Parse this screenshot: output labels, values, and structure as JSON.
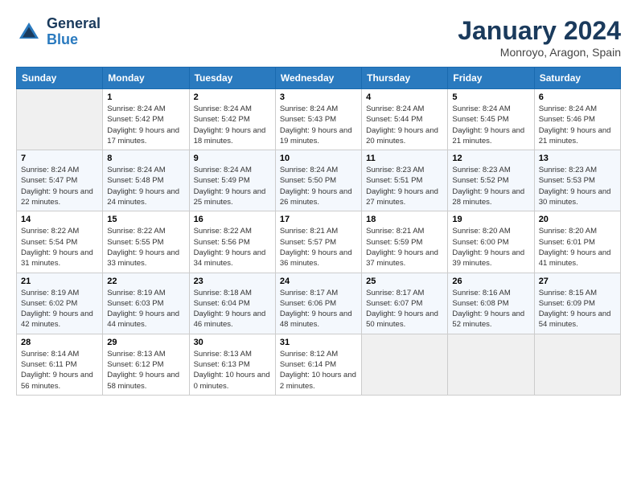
{
  "header": {
    "logo_line1": "General",
    "logo_line2": "Blue",
    "title": "January 2024",
    "subtitle": "Monroyo, Aragon, Spain"
  },
  "weekdays": [
    "Sunday",
    "Monday",
    "Tuesday",
    "Wednesday",
    "Thursday",
    "Friday",
    "Saturday"
  ],
  "weeks": [
    [
      {
        "day": "",
        "sunrise": "",
        "sunset": "",
        "daylight": ""
      },
      {
        "day": "1",
        "sunrise": "Sunrise: 8:24 AM",
        "sunset": "Sunset: 5:42 PM",
        "daylight": "Daylight: 9 hours and 17 minutes."
      },
      {
        "day": "2",
        "sunrise": "Sunrise: 8:24 AM",
        "sunset": "Sunset: 5:42 PM",
        "daylight": "Daylight: 9 hours and 18 minutes."
      },
      {
        "day": "3",
        "sunrise": "Sunrise: 8:24 AM",
        "sunset": "Sunset: 5:43 PM",
        "daylight": "Daylight: 9 hours and 19 minutes."
      },
      {
        "day": "4",
        "sunrise": "Sunrise: 8:24 AM",
        "sunset": "Sunset: 5:44 PM",
        "daylight": "Daylight: 9 hours and 20 minutes."
      },
      {
        "day": "5",
        "sunrise": "Sunrise: 8:24 AM",
        "sunset": "Sunset: 5:45 PM",
        "daylight": "Daylight: 9 hours and 21 minutes."
      },
      {
        "day": "6",
        "sunrise": "Sunrise: 8:24 AM",
        "sunset": "Sunset: 5:46 PM",
        "daylight": "Daylight: 9 hours and 21 minutes."
      }
    ],
    [
      {
        "day": "7",
        "sunrise": "Sunrise: 8:24 AM",
        "sunset": "Sunset: 5:47 PM",
        "daylight": "Daylight: 9 hours and 22 minutes."
      },
      {
        "day": "8",
        "sunrise": "Sunrise: 8:24 AM",
        "sunset": "Sunset: 5:48 PM",
        "daylight": "Daylight: 9 hours and 24 minutes."
      },
      {
        "day": "9",
        "sunrise": "Sunrise: 8:24 AM",
        "sunset": "Sunset: 5:49 PM",
        "daylight": "Daylight: 9 hours and 25 minutes."
      },
      {
        "day": "10",
        "sunrise": "Sunrise: 8:24 AM",
        "sunset": "Sunset: 5:50 PM",
        "daylight": "Daylight: 9 hours and 26 minutes."
      },
      {
        "day": "11",
        "sunrise": "Sunrise: 8:23 AM",
        "sunset": "Sunset: 5:51 PM",
        "daylight": "Daylight: 9 hours and 27 minutes."
      },
      {
        "day": "12",
        "sunrise": "Sunrise: 8:23 AM",
        "sunset": "Sunset: 5:52 PM",
        "daylight": "Daylight: 9 hours and 28 minutes."
      },
      {
        "day": "13",
        "sunrise": "Sunrise: 8:23 AM",
        "sunset": "Sunset: 5:53 PM",
        "daylight": "Daylight: 9 hours and 30 minutes."
      }
    ],
    [
      {
        "day": "14",
        "sunrise": "Sunrise: 8:22 AM",
        "sunset": "Sunset: 5:54 PM",
        "daylight": "Daylight: 9 hours and 31 minutes."
      },
      {
        "day": "15",
        "sunrise": "Sunrise: 8:22 AM",
        "sunset": "Sunset: 5:55 PM",
        "daylight": "Daylight: 9 hours and 33 minutes."
      },
      {
        "day": "16",
        "sunrise": "Sunrise: 8:22 AM",
        "sunset": "Sunset: 5:56 PM",
        "daylight": "Daylight: 9 hours and 34 minutes."
      },
      {
        "day": "17",
        "sunrise": "Sunrise: 8:21 AM",
        "sunset": "Sunset: 5:57 PM",
        "daylight": "Daylight: 9 hours and 36 minutes."
      },
      {
        "day": "18",
        "sunrise": "Sunrise: 8:21 AM",
        "sunset": "Sunset: 5:59 PM",
        "daylight": "Daylight: 9 hours and 37 minutes."
      },
      {
        "day": "19",
        "sunrise": "Sunrise: 8:20 AM",
        "sunset": "Sunset: 6:00 PM",
        "daylight": "Daylight: 9 hours and 39 minutes."
      },
      {
        "day": "20",
        "sunrise": "Sunrise: 8:20 AM",
        "sunset": "Sunset: 6:01 PM",
        "daylight": "Daylight: 9 hours and 41 minutes."
      }
    ],
    [
      {
        "day": "21",
        "sunrise": "Sunrise: 8:19 AM",
        "sunset": "Sunset: 6:02 PM",
        "daylight": "Daylight: 9 hours and 42 minutes."
      },
      {
        "day": "22",
        "sunrise": "Sunrise: 8:19 AM",
        "sunset": "Sunset: 6:03 PM",
        "daylight": "Daylight: 9 hours and 44 minutes."
      },
      {
        "day": "23",
        "sunrise": "Sunrise: 8:18 AM",
        "sunset": "Sunset: 6:04 PM",
        "daylight": "Daylight: 9 hours and 46 minutes."
      },
      {
        "day": "24",
        "sunrise": "Sunrise: 8:17 AM",
        "sunset": "Sunset: 6:06 PM",
        "daylight": "Daylight: 9 hours and 48 minutes."
      },
      {
        "day": "25",
        "sunrise": "Sunrise: 8:17 AM",
        "sunset": "Sunset: 6:07 PM",
        "daylight": "Daylight: 9 hours and 50 minutes."
      },
      {
        "day": "26",
        "sunrise": "Sunrise: 8:16 AM",
        "sunset": "Sunset: 6:08 PM",
        "daylight": "Daylight: 9 hours and 52 minutes."
      },
      {
        "day": "27",
        "sunrise": "Sunrise: 8:15 AM",
        "sunset": "Sunset: 6:09 PM",
        "daylight": "Daylight: 9 hours and 54 minutes."
      }
    ],
    [
      {
        "day": "28",
        "sunrise": "Sunrise: 8:14 AM",
        "sunset": "Sunset: 6:11 PM",
        "daylight": "Daylight: 9 hours and 56 minutes."
      },
      {
        "day": "29",
        "sunrise": "Sunrise: 8:13 AM",
        "sunset": "Sunset: 6:12 PM",
        "daylight": "Daylight: 9 hours and 58 minutes."
      },
      {
        "day": "30",
        "sunrise": "Sunrise: 8:13 AM",
        "sunset": "Sunset: 6:13 PM",
        "daylight": "Daylight: 10 hours and 0 minutes."
      },
      {
        "day": "31",
        "sunrise": "Sunrise: 8:12 AM",
        "sunset": "Sunset: 6:14 PM",
        "daylight": "Daylight: 10 hours and 2 minutes."
      },
      {
        "day": "",
        "sunrise": "",
        "sunset": "",
        "daylight": ""
      },
      {
        "day": "",
        "sunrise": "",
        "sunset": "",
        "daylight": ""
      },
      {
        "day": "",
        "sunrise": "",
        "sunset": "",
        "daylight": ""
      }
    ]
  ]
}
